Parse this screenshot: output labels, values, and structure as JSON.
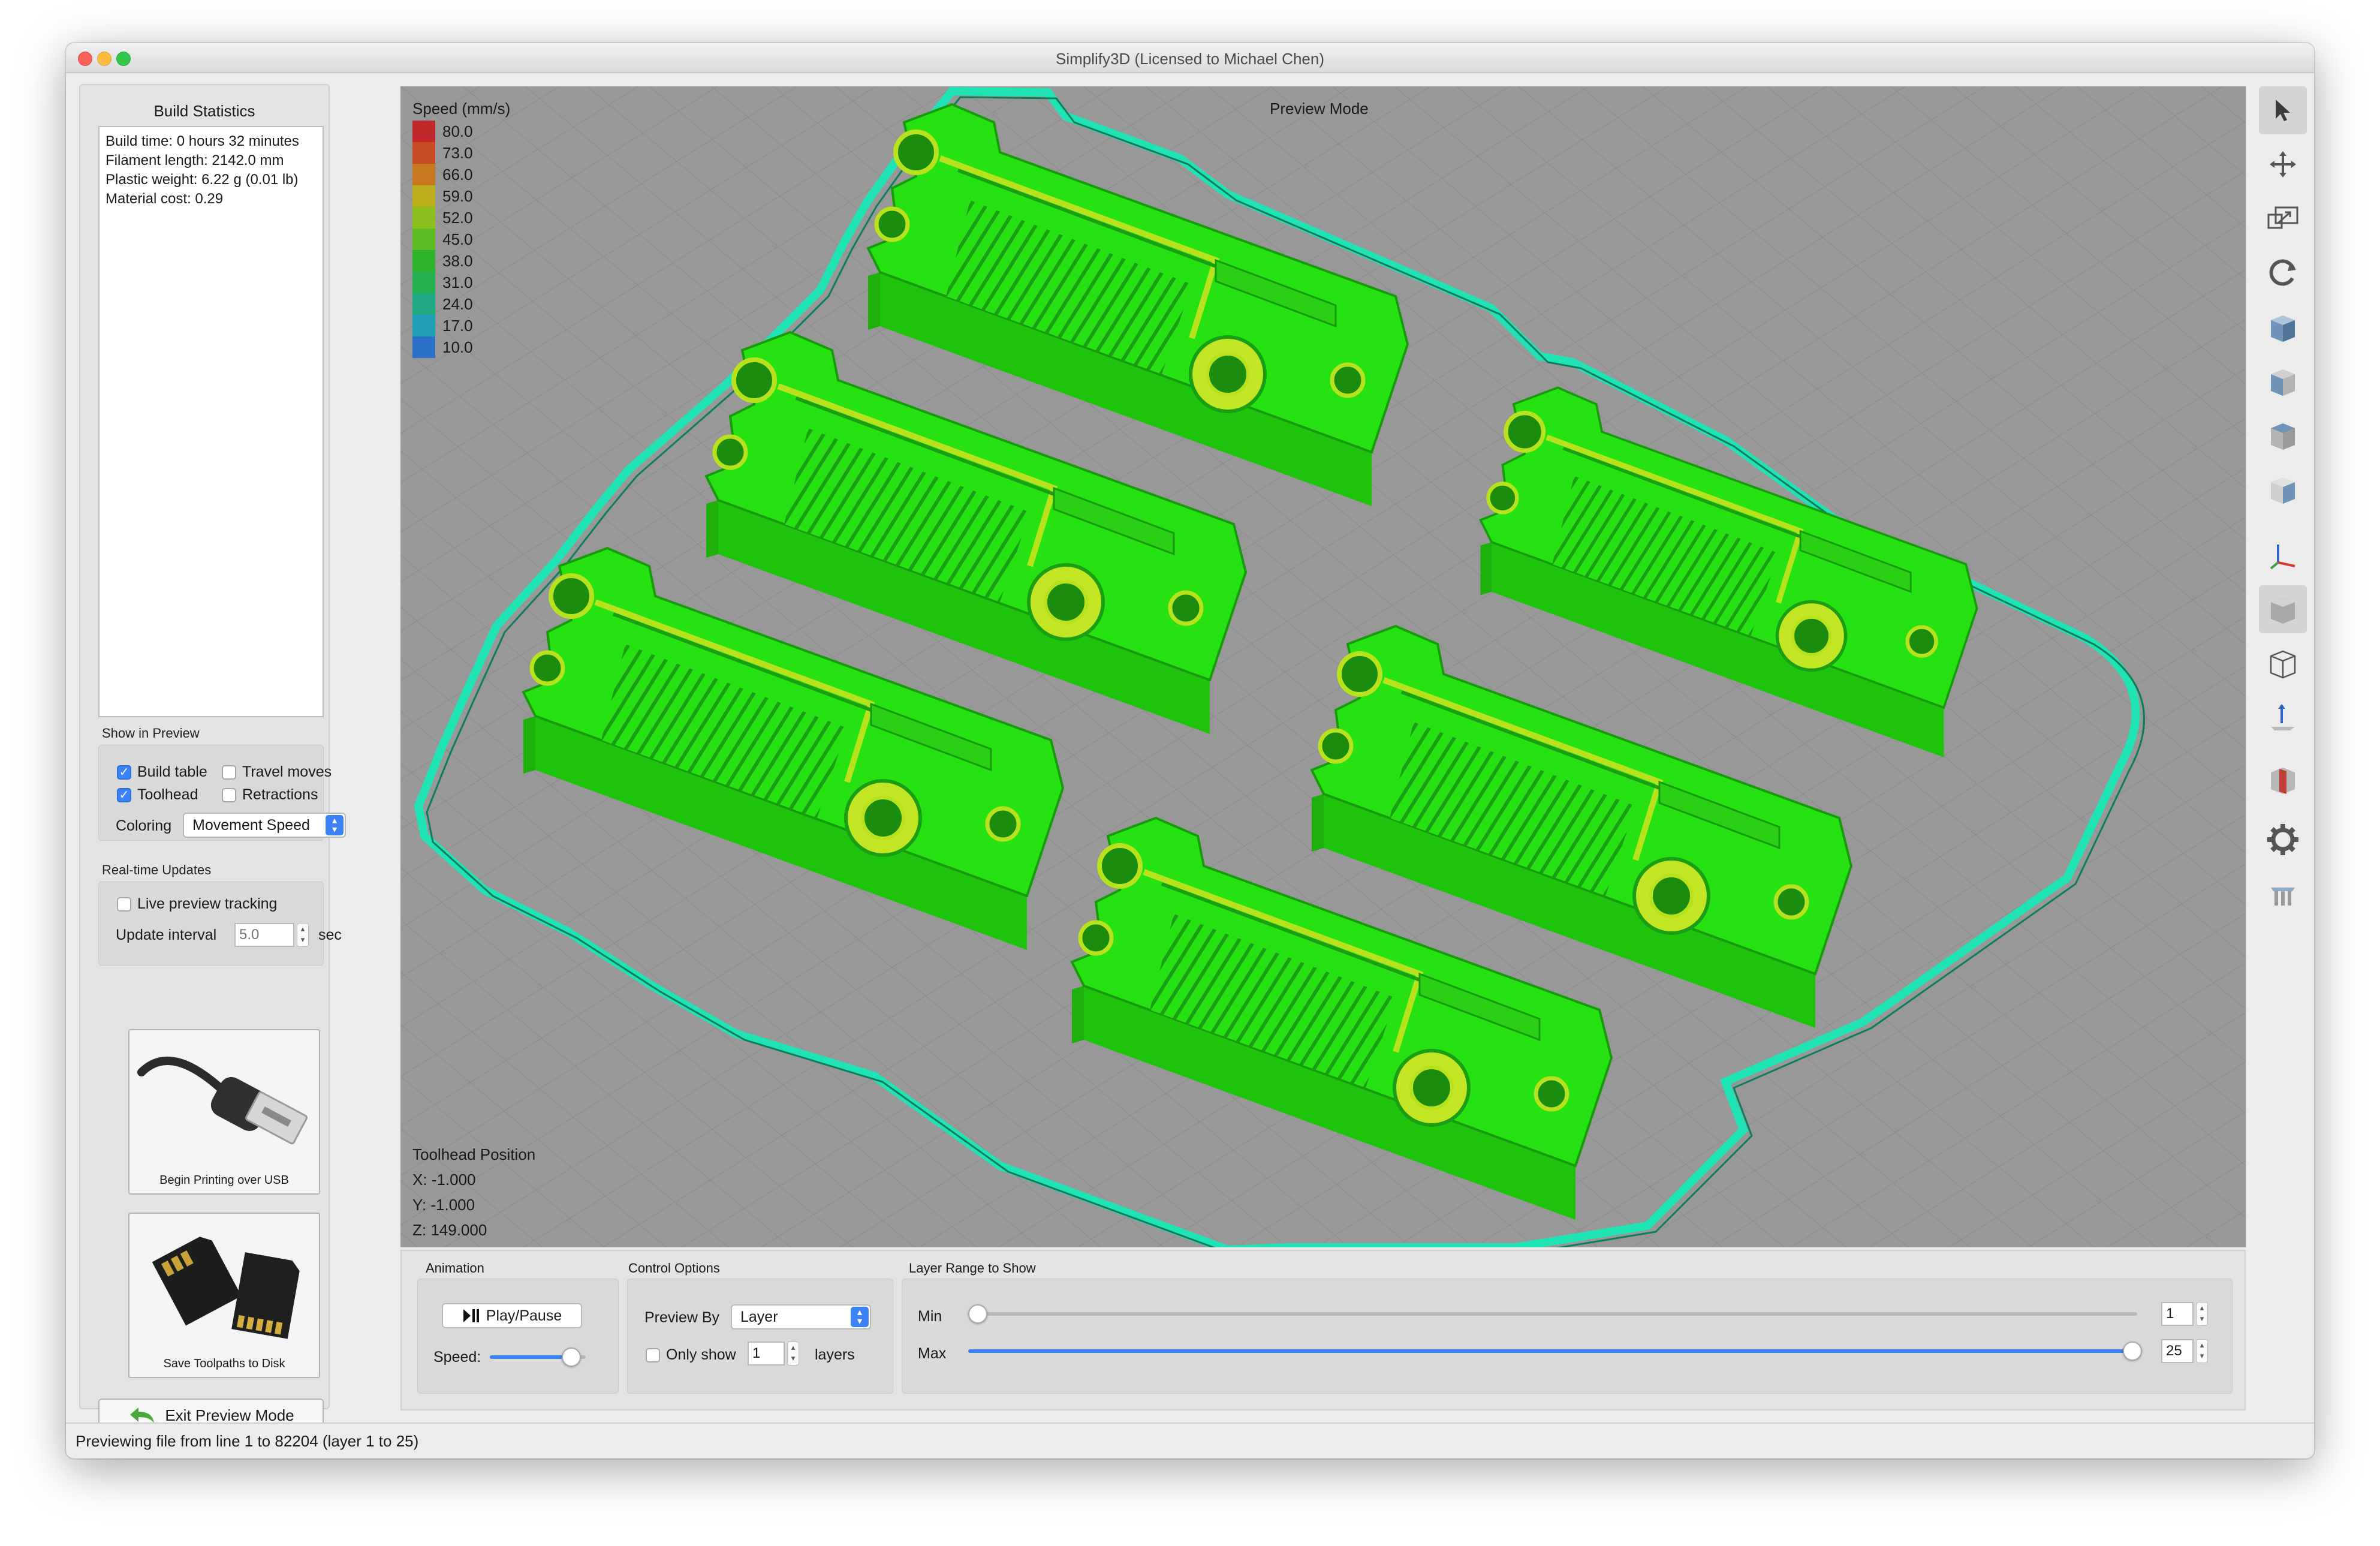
{
  "window": {
    "title": "Simplify3D (Licensed to Michael Chen)"
  },
  "build_stats": {
    "heading": "Build Statistics",
    "lines": [
      "Build time: 0 hours 32 minutes",
      "Filament length: 2142.0 mm",
      "Plastic weight: 6.22 g (0.01 lb)",
      "Material cost: 0.29"
    ]
  },
  "show_in_preview": {
    "heading": "Show in Preview",
    "build_table": {
      "label": "Build table",
      "checked": true
    },
    "travel_moves": {
      "label": "Travel moves",
      "checked": false
    },
    "toolhead": {
      "label": "Toolhead",
      "checked": true
    },
    "retractions": {
      "label": "Retractions",
      "checked": false
    },
    "coloring_label": "Coloring",
    "coloring_value": "Movement Speed"
  },
  "realtime": {
    "heading": "Real-time Updates",
    "live_tracking": {
      "label": "Live preview tracking",
      "checked": false
    },
    "interval_label": "Update interval",
    "interval_placeholder": "5.0",
    "interval_unit": "sec"
  },
  "actions": {
    "usb_label": "Begin Printing over USB",
    "disk_label": "Save Toolpaths to Disk",
    "exit_label": "Exit Preview Mode"
  },
  "viewport": {
    "mode_label": "Preview Mode",
    "legend_title": "Speed (mm/s)",
    "legend": [
      {
        "value": "80.0",
        "color": "#c0282a"
      },
      {
        "value": "73.0",
        "color": "#c84a22"
      },
      {
        "value": "66.0",
        "color": "#c8781e"
      },
      {
        "value": "59.0",
        "color": "#bcae1c"
      },
      {
        "value": "52.0",
        "color": "#8cbe1e"
      },
      {
        "value": "45.0",
        "color": "#5cbe22"
      },
      {
        "value": "38.0",
        "color": "#2eb42a"
      },
      {
        "value": "31.0",
        "color": "#22b050"
      },
      {
        "value": "24.0",
        "color": "#20aa84"
      },
      {
        "value": "17.0",
        "color": "#20a0b4"
      },
      {
        "value": "10.0",
        "color": "#2a70c8"
      }
    ],
    "toolhead_title": "Toolhead Position",
    "toolhead_x": "X: -1.000",
    "toolhead_y": "Y: -1.000",
    "toolhead_z": "Z: 149.000",
    "part_color": "#22ee0a",
    "outline_color": "#1fe3b4"
  },
  "right_toolbar": [
    "select-icon",
    "move-icon",
    "scale-icon",
    "rotate-icon",
    "view-iso-icon",
    "view-front-icon",
    "view-top-icon",
    "view-side-icon",
    "axes-icon",
    "solid-cube-icon",
    "wireframe-cube-icon",
    "show-axis-icon",
    "cross-section-icon",
    "gear-icon",
    "bed-icon"
  ],
  "animation": {
    "heading": "Animation",
    "play_label": "Play/Pause",
    "speed_label": "Speed:",
    "speed_level": 0.85
  },
  "control_options": {
    "heading": "Control Options",
    "preview_by_label": "Preview By",
    "preview_by_value": "Layer",
    "only_show_label": "Only show",
    "only_show_value": "1",
    "layers_label": "layers"
  },
  "layer_range": {
    "heading": "Layer Range to Show",
    "min_label": "Min",
    "min_value": "1",
    "max_label": "Max",
    "max_value": "25"
  },
  "status": {
    "text": "Previewing file from line 1 to 82204 (layer 1 to 25)"
  }
}
